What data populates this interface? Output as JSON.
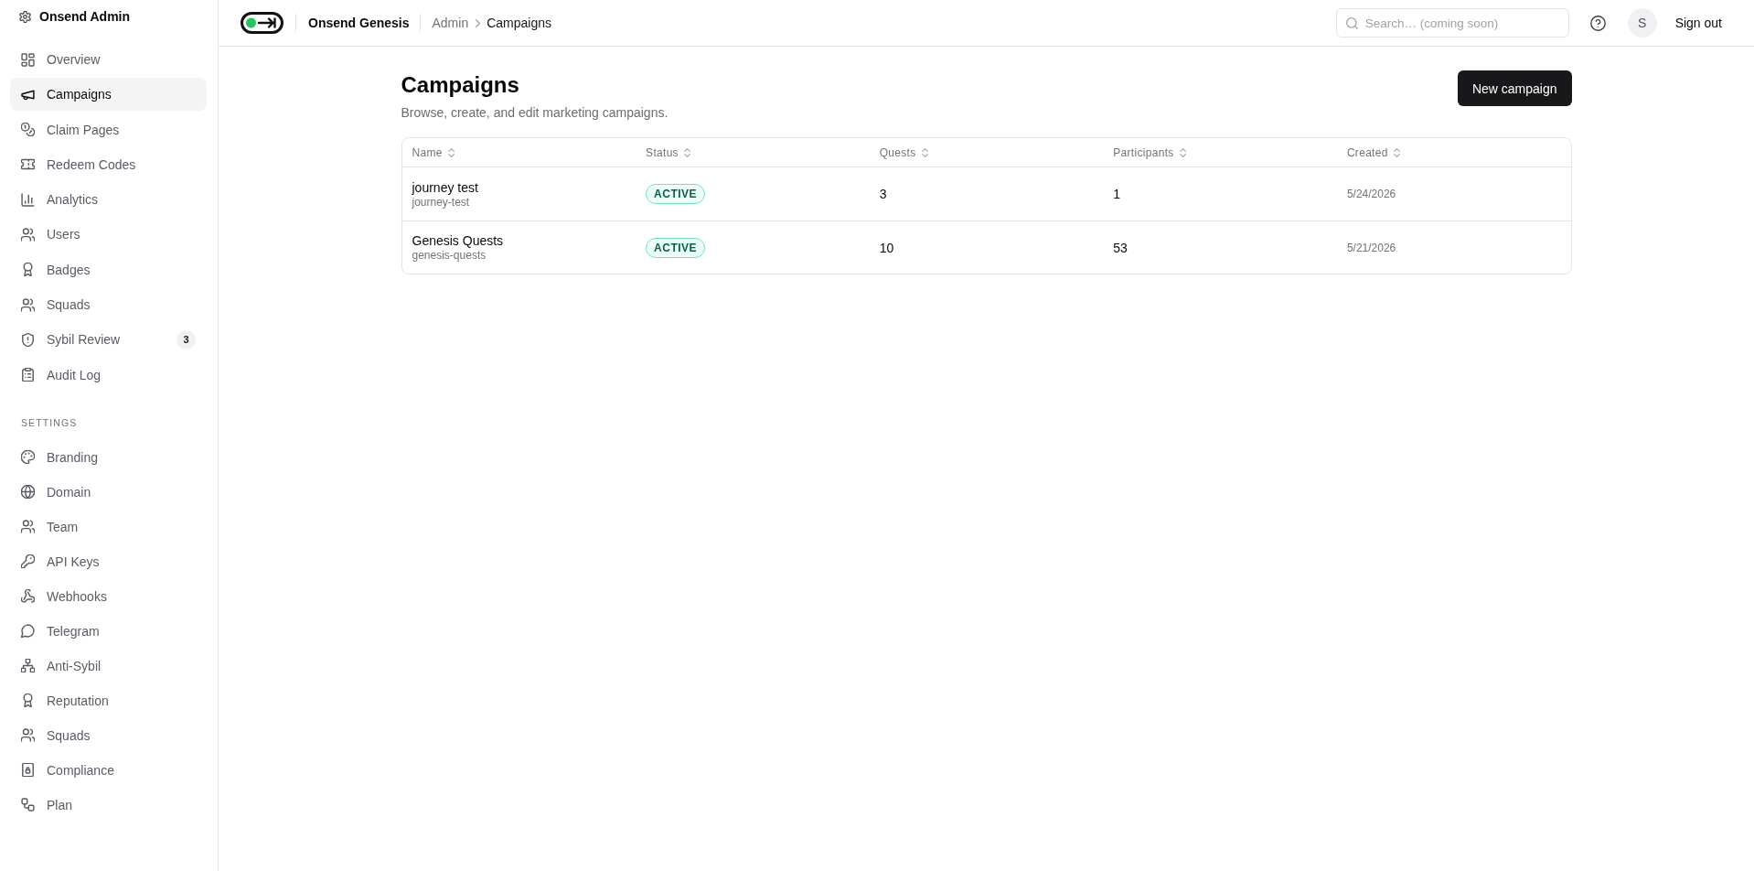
{
  "sidebar": {
    "title": "Onsend Admin",
    "items": [
      {
        "label": "Overview",
        "selected": false
      },
      {
        "label": "Campaigns",
        "selected": true
      },
      {
        "label": "Claim Pages",
        "selected": false
      },
      {
        "label": "Redeem Codes",
        "selected": false
      },
      {
        "label": "Analytics",
        "selected": false
      },
      {
        "label": "Users",
        "selected": false
      },
      {
        "label": "Badges",
        "selected": false
      },
      {
        "label": "Squads",
        "selected": false
      },
      {
        "label": "Sybil Review",
        "selected": false,
        "badge": "3"
      },
      {
        "label": "Audit Log",
        "selected": false
      }
    ],
    "settings": {
      "heading": "SETTINGS",
      "items": [
        {
          "label": "Branding",
          "selected": false
        },
        {
          "label": "Domain",
          "selected": false
        },
        {
          "label": "Team",
          "selected": false
        },
        {
          "label": "API Keys",
          "selected": false
        },
        {
          "label": "Webhooks",
          "selected": false
        },
        {
          "label": "Telegram",
          "selected": false
        },
        {
          "label": "Anti-Sybil",
          "selected": false
        },
        {
          "label": "Reputation",
          "selected": false
        },
        {
          "label": "Squads",
          "selected": false
        },
        {
          "label": "Compliance",
          "selected": false
        },
        {
          "label": "Plan",
          "selected": false
        }
      ]
    }
  },
  "header": {
    "brand": "Onsend Genesis",
    "breadcrumb": [
      "Admin",
      "Campaigns"
    ],
    "search": {
      "placeholder": "Search… (coming soon)"
    },
    "avatar": "S",
    "sign_out": "Sign out"
  },
  "page": {
    "title": "Campaigns",
    "subtitle": "Browse, create, and edit marketing campaigns.",
    "primary_button": "New campaign"
  },
  "table": {
    "columns": [
      "Name",
      "Status",
      "Quests",
      "Participants",
      "Created"
    ],
    "rows": [
      {
        "name": "journey test",
        "slug": "journey-test",
        "status": "ACTIVE",
        "quests": "3",
        "participants": "1",
        "created": "5/24/2026"
      },
      {
        "name": "Genesis Quests",
        "slug": "genesis-quests",
        "status": "ACTIVE",
        "quests": "10",
        "participants": "53",
        "created": "5/21/2026"
      }
    ]
  }
}
